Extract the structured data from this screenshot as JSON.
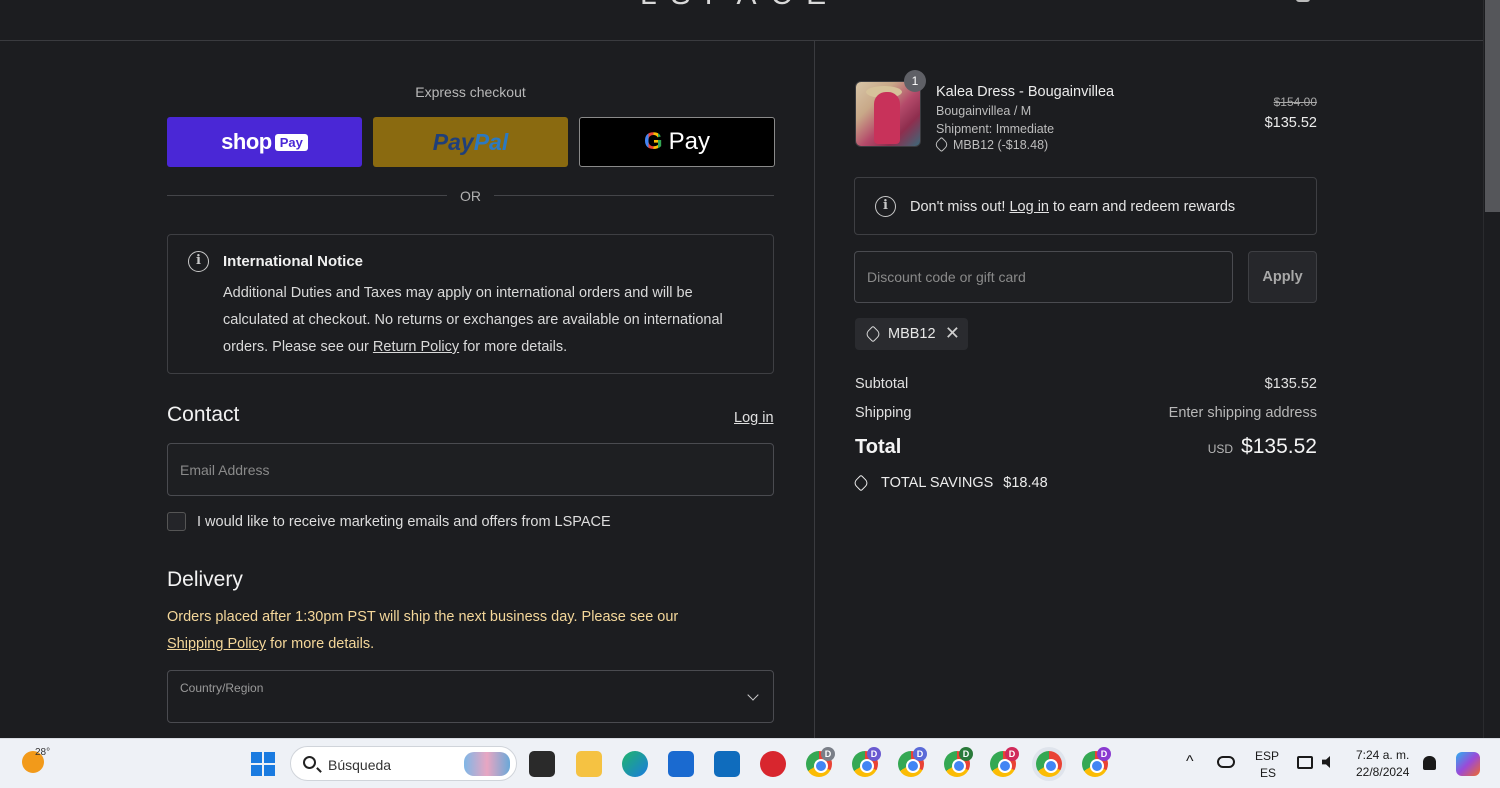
{
  "header": {
    "logo": "LSPACE"
  },
  "express": {
    "title": "Express checkout",
    "shop_label": "shop",
    "shop_badge": "Pay",
    "paypal_a": "Pay",
    "paypal_b": "Pal",
    "gpay_g": "G",
    "gpay_label": "Pay",
    "or": "OR"
  },
  "notice": {
    "title": "International Notice",
    "text_before": "Additional Duties and Taxes may apply on international orders and will be calculated at checkout. No returns or exchanges are available on international orders. Please see our ",
    "link": "Return Policy",
    "text_after": " for more details."
  },
  "contact": {
    "title": "Contact",
    "login": "Log in",
    "email_placeholder": "Email Address",
    "marketing_label": "I would like to receive marketing emails and offers from LSPACE"
  },
  "delivery": {
    "title": "Delivery",
    "note_before": "Orders placed after 1:30pm PST will ship the next business day. Please see our ",
    "note_link": "Shipping Policy",
    "note_after": " for more details.",
    "country_label": "Country/Region"
  },
  "order": {
    "quantity": "1",
    "product_name": "Kalea Dress - Bougainvillea",
    "variant": "Bougainvillea / M",
    "shipment": "Shipment: Immediate",
    "discount_line": "MBB12 (-$18.48)",
    "price_original": "$154.00",
    "price_final": "$135.52"
  },
  "rewards": {
    "before": "Don't miss out! ",
    "link": "Log in",
    "after": " to earn and redeem rewards"
  },
  "discount": {
    "placeholder": "Discount code or gift card",
    "apply": "Apply",
    "applied_code": "MBB12",
    "remove_glyph": "✕"
  },
  "summary": {
    "subtotal_label": "Subtotal",
    "subtotal_value": "$135.52",
    "shipping_label": "Shipping",
    "shipping_value": "Enter shipping address",
    "total_label": "Total",
    "currency": "USD",
    "total_value": "$135.52",
    "savings_label": "TOTAL SAVINGS",
    "savings_value": "$18.48"
  },
  "taskbar": {
    "temperature": "28°",
    "search_label": "Búsqueda",
    "chrome_badges": [
      "D",
      "D",
      "D",
      "D",
      "D",
      "",
      "D"
    ],
    "lang_top": "ESP",
    "lang_bottom": "ES",
    "time": "7:24 a. m.",
    "date": "22/8/2024",
    "caret": "^"
  },
  "colors": {
    "background": "#1c1d20",
    "shop_pay": "#4a27d6",
    "paypal": "#8a6a10",
    "delivery_note": "#f4d79a"
  }
}
